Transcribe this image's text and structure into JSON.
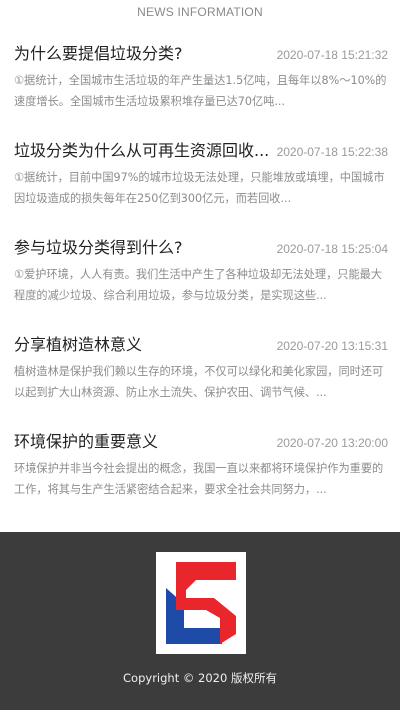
{
  "header": {
    "section_title": "NEWS INFORMATION"
  },
  "news": [
    {
      "title": "为什么要提倡垃圾分类?",
      "date": "2020-07-18 15:21:32",
      "summary": "①据统计，全国城市生活垃圾的年产生量达1.5亿吨，且每年以8%～10%的速度增长。全国城市生活垃圾累积堆存量已达70亿吨..."
    },
    {
      "title": "垃圾分类为什么从可再生资源回收...",
      "date": "2020-07-18 15:22:38",
      "summary": "①据统计，目前中国97%的城市垃圾无法处理，只能堆放或填埋，中国城市因垃圾造成的损失每年在250亿到300亿元，而若回收..."
    },
    {
      "title": "参与垃圾分类得到什么?",
      "date": "2020-07-18 15:25:04",
      "summary": "①爱护环境，人人有责。我们生活中产生了各种垃圾却无法处理，只能最大程度的减少垃圾、综合利用垃圾，参与垃圾分类，是实现这些..."
    },
    {
      "title": "分享植树造林意义",
      "date": "2020-07-20 13:15:31",
      "summary": "植树造林是保护我们赖以生存的环境，不仅可以绿化和美化家园，同时还可以起到扩大山林资源、防止水土流失、保护农田、调节气候、..."
    },
    {
      "title": "环境保护的重要意义",
      "date": "2020-07-20 13:20:00",
      "summary": "环境保护并非当今社会提出的概念，我国一直以来都将环境保护作为重要的工作，将其与生产生活紧密结合起来，要求全社会共同努力，..."
    }
  ],
  "footer": {
    "logo_icon": "company-logo-icon",
    "copyright": "Copyright © 2020 版权所有"
  },
  "colors": {
    "footer_bg": "#3c3c3c",
    "logo_red": "#e8262b",
    "logo_blue": "#1e4aa8"
  }
}
